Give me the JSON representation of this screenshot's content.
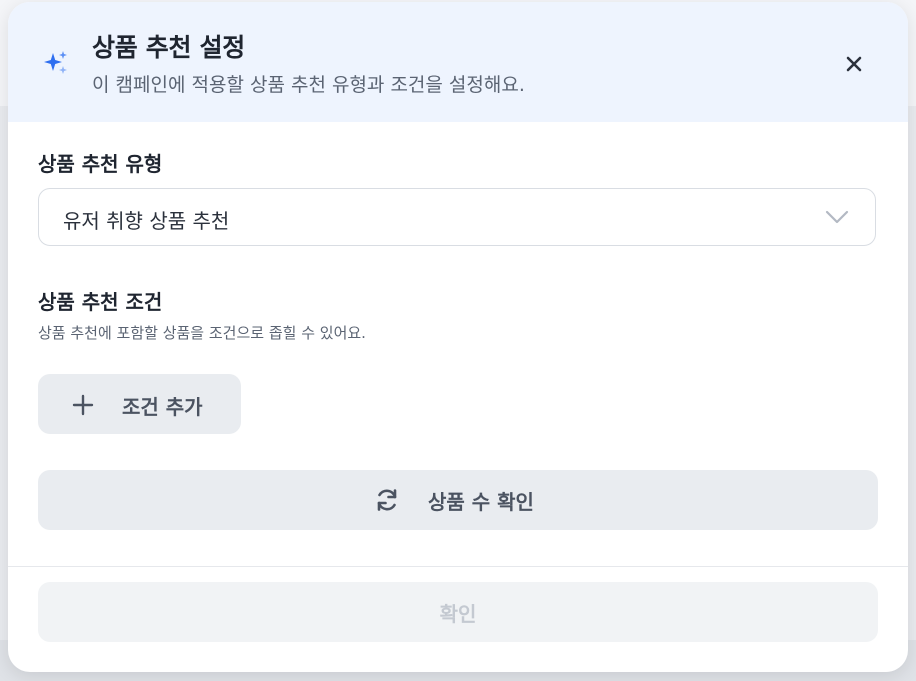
{
  "header": {
    "title": "상품 추천 설정",
    "subtitle": "이 캠페인에 적용할 상품 추천 유형과 조건을 설정해요.",
    "icon": "sparkle-icon",
    "close_icon": "close-icon"
  },
  "recommendation_type": {
    "label": "상품 추천 유형",
    "selected": "유저 취향 상품 추천"
  },
  "conditions": {
    "label": "상품 추천 조건",
    "description": "상품 추천에 포함할 상품을 조건으로 좁힐 수 있어요.",
    "add_button": "조건 추가"
  },
  "check_count_button": "상품 수 확인",
  "confirm_button": "확인",
  "colors": {
    "accent": "#2f6ff0",
    "header_bg": "#eef4fe"
  }
}
